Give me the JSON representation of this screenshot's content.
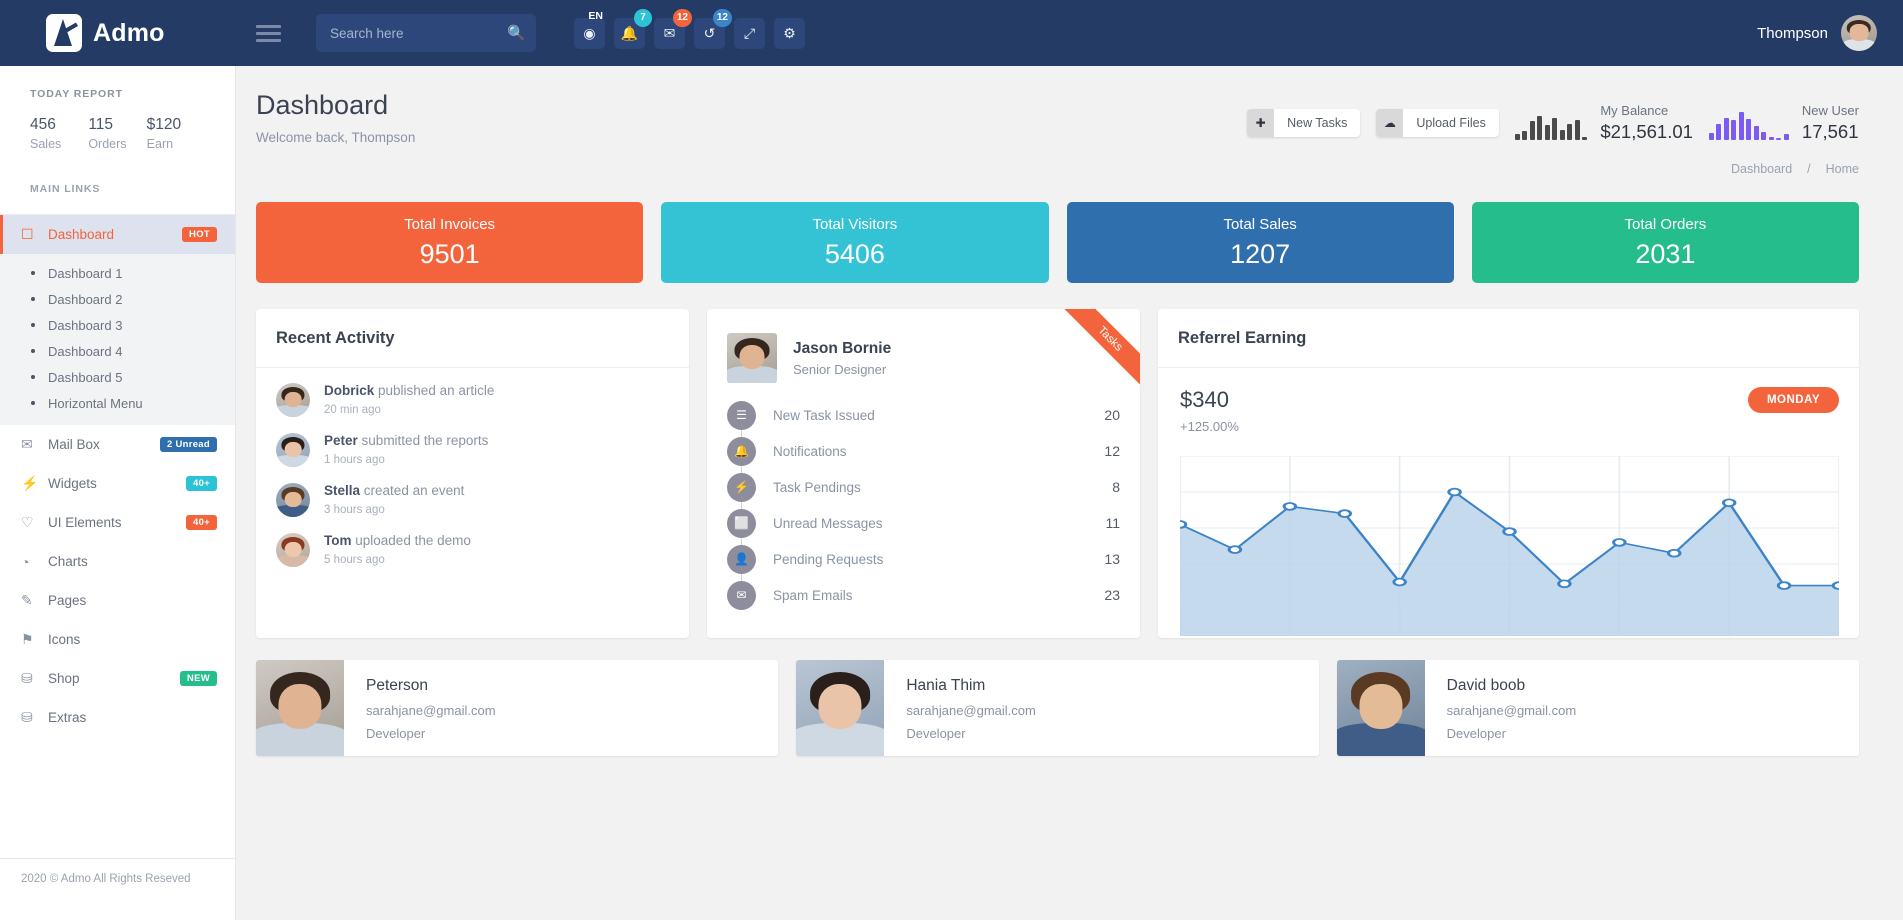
{
  "navbar": {
    "brand": "Admo",
    "search_placeholder": "Search here",
    "search_value": "",
    "icons": [
      {
        "name": "globe-icon",
        "glyph": "♁",
        "badge": "EN",
        "badge_style": "lang"
      },
      {
        "name": "bell-icon",
        "glyph": "ὑ4",
        "badge": "7",
        "badge_style": "cyan"
      },
      {
        "name": "envelope-icon",
        "glyph": "✉",
        "badge": "12",
        "badge_style": "orange"
      },
      {
        "name": "history-icon",
        "glyph": "↺",
        "badge": "12",
        "badge_style": "blue"
      },
      {
        "name": "fullscreen-icon",
        "glyph": "⤢",
        "badge": "",
        "badge_style": ""
      },
      {
        "name": "gear-icon",
        "glyph": "⚙",
        "badge": "",
        "badge_style": ""
      }
    ],
    "user_name": "Thompson"
  },
  "sidebar": {
    "today_report_caption": "TODAY REPORT",
    "stats": [
      {
        "value": "456",
        "label": "Sales"
      },
      {
        "value": "115",
        "label": "Orders"
      },
      {
        "value": "$120",
        "label": "Earn"
      }
    ],
    "main_links_caption": "MAIN LINKS",
    "items": [
      {
        "label": "Dashboard",
        "icon": "desktop-icon",
        "glyph": "☐",
        "badge": "HOT",
        "badge_class": "hot",
        "active": true
      },
      {
        "label": "Mail Box",
        "icon": "mail-icon",
        "glyph": "✉",
        "badge": "2 Unread",
        "badge_class": "bl",
        "active": false
      },
      {
        "label": "Widgets",
        "icon": "bolt-icon",
        "glyph": "⚡",
        "badge": "40+",
        "badge_class": "cy",
        "active": false
      },
      {
        "label": "UI Elements",
        "icon": "heart-icon",
        "glyph": "♡",
        "badge": "40+",
        "badge_class": "or",
        "active": false
      },
      {
        "label": "Charts",
        "icon": "pie-chart-icon",
        "glyph": "◔",
        "badge": "",
        "badge_class": "",
        "active": false
      },
      {
        "label": "Pages",
        "icon": "pencil-icon",
        "glyph": "✎",
        "badge": "",
        "badge_class": "",
        "active": false
      },
      {
        "label": "Icons",
        "icon": "flag-icon",
        "glyph": "⚑",
        "badge": "",
        "badge_class": "",
        "active": false
      },
      {
        "label": "Shop",
        "icon": "bag-icon",
        "glyph": "⛁",
        "badge": "NEW",
        "badge_class": "gr",
        "active": false
      },
      {
        "label": "Extras",
        "icon": "layers-icon",
        "glyph": "⛁",
        "badge": "",
        "badge_class": "",
        "active": false
      }
    ],
    "submenu": [
      {
        "label": "Dashboard 1"
      },
      {
        "label": "Dashboard 2"
      },
      {
        "label": "Dashboard 3"
      },
      {
        "label": "Dashboard 4"
      },
      {
        "label": "Dashboard 5"
      },
      {
        "label": "Horizontal Menu"
      }
    ],
    "footer": "2020 © Admo All Rights Reseved"
  },
  "page": {
    "title": "Dashboard",
    "subtitle": "Welcome back, Thompson",
    "breadcrumb": [
      {
        "label": "Dashboard"
      },
      {
        "label": "/"
      },
      {
        "label": "Home"
      }
    ],
    "actions": [
      {
        "name": "new-tasks-button",
        "icon_glyph": "✚",
        "label": "New Tasks"
      },
      {
        "name": "upload-files-button",
        "icon_glyph": "☁",
        "label": "Upload Files"
      }
    ],
    "widgets": [
      {
        "label": "My Balance",
        "value": "$21,561.01",
        "color": "#4a4a4a",
        "bars": [
          18,
          26,
          55,
          72,
          44,
          64,
          30,
          48,
          60,
          8
        ]
      },
      {
        "label": "New User",
        "value": "17,561",
        "color": "#7c5cf0",
        "bars": [
          22,
          46,
          66,
          58,
          82,
          62,
          40,
          24,
          8,
          6,
          18
        ]
      }
    ]
  },
  "stat_cards": [
    {
      "title": "Total Invoices",
      "value": "9501",
      "color": "#f4643c"
    },
    {
      "title": "Total Visitors",
      "value": "5406",
      "color": "#33c3d4"
    },
    {
      "title": "Total Sales",
      "value": "1207",
      "color": "#2f6fad"
    },
    {
      "title": "Total Orders",
      "value": "2031",
      "color": "#25bd8b"
    }
  ],
  "recent_activity": {
    "title": "Recent Activity",
    "items": [
      {
        "user": "Dobrick",
        "action": "published an article",
        "time": "20 min ago",
        "avatar": "male-dark"
      },
      {
        "user": "Peter",
        "action": "submitted the reports",
        "time": "1 hours ago",
        "avatar": "female-dark"
      },
      {
        "user": "Stella",
        "action": "created an event",
        "time": "3 hours ago",
        "avatar": "male-curly"
      },
      {
        "user": "Tom",
        "action": "uploaded the demo",
        "time": "5 hours ago",
        "avatar": "female-red"
      }
    ]
  },
  "tasks_panel": {
    "ribbon_label": "Tasks",
    "user_name": "Jason Bornie",
    "user_role": "Senior Designer",
    "rows": [
      {
        "icon": "list-icon",
        "glyph": "☰",
        "label": "New Task Issued",
        "value": "20"
      },
      {
        "icon": "bell-icon",
        "glyph": "ὑ4",
        "label": "Notifications",
        "value": "12"
      },
      {
        "icon": "bolt-icon",
        "glyph": "⚡",
        "label": "Task Pendings",
        "value": "8"
      },
      {
        "icon": "inbox-icon",
        "glyph": "☐",
        "label": "Unread Messages",
        "value": "11"
      },
      {
        "icon": "user-icon",
        "glyph": "♟",
        "label": "Pending Requests",
        "value": "13"
      },
      {
        "icon": "envelope-icon",
        "glyph": "✉",
        "label": "Spam Emails",
        "value": "23"
      }
    ]
  },
  "referrel": {
    "title": "Referrel Earning",
    "amount": "$340",
    "percent": "+125.00%",
    "day_button": "MONDAY"
  },
  "chart_data": {
    "type": "area",
    "title": "Referrel Earning",
    "x": [
      1,
      2,
      3,
      4,
      5,
      6,
      7,
      8,
      9,
      10,
      11,
      12,
      13
    ],
    "values": [
      62,
      48,
      72,
      68,
      30,
      80,
      58,
      29,
      52,
      46,
      74,
      28,
      28
    ],
    "series": [
      {
        "name": "Referrel Earning",
        "values": [
          62,
          48,
          72,
          68,
          30,
          80,
          58,
          29,
          52,
          46,
          74,
          28,
          28
        ]
      }
    ],
    "ylim": [
      0,
      100
    ],
    "xlabel": "",
    "ylabel": "",
    "grid": true,
    "legend": "none",
    "line_color": "#3d84c6",
    "fill_color": "#bcd4ea",
    "marker": "circle-open"
  },
  "profile_cards": [
    {
      "name": "Peterson",
      "email": "sarahjane@gmail.com",
      "role": "Developer",
      "photo": "male-dark"
    },
    {
      "name": "Hania Thim",
      "email": "sarahjane@gmail.com",
      "role": "Developer",
      "photo": "female-dark"
    },
    {
      "name": "David boob",
      "email": "sarahjane@gmail.com",
      "role": "Developer",
      "photo": "male-curly"
    }
  ]
}
